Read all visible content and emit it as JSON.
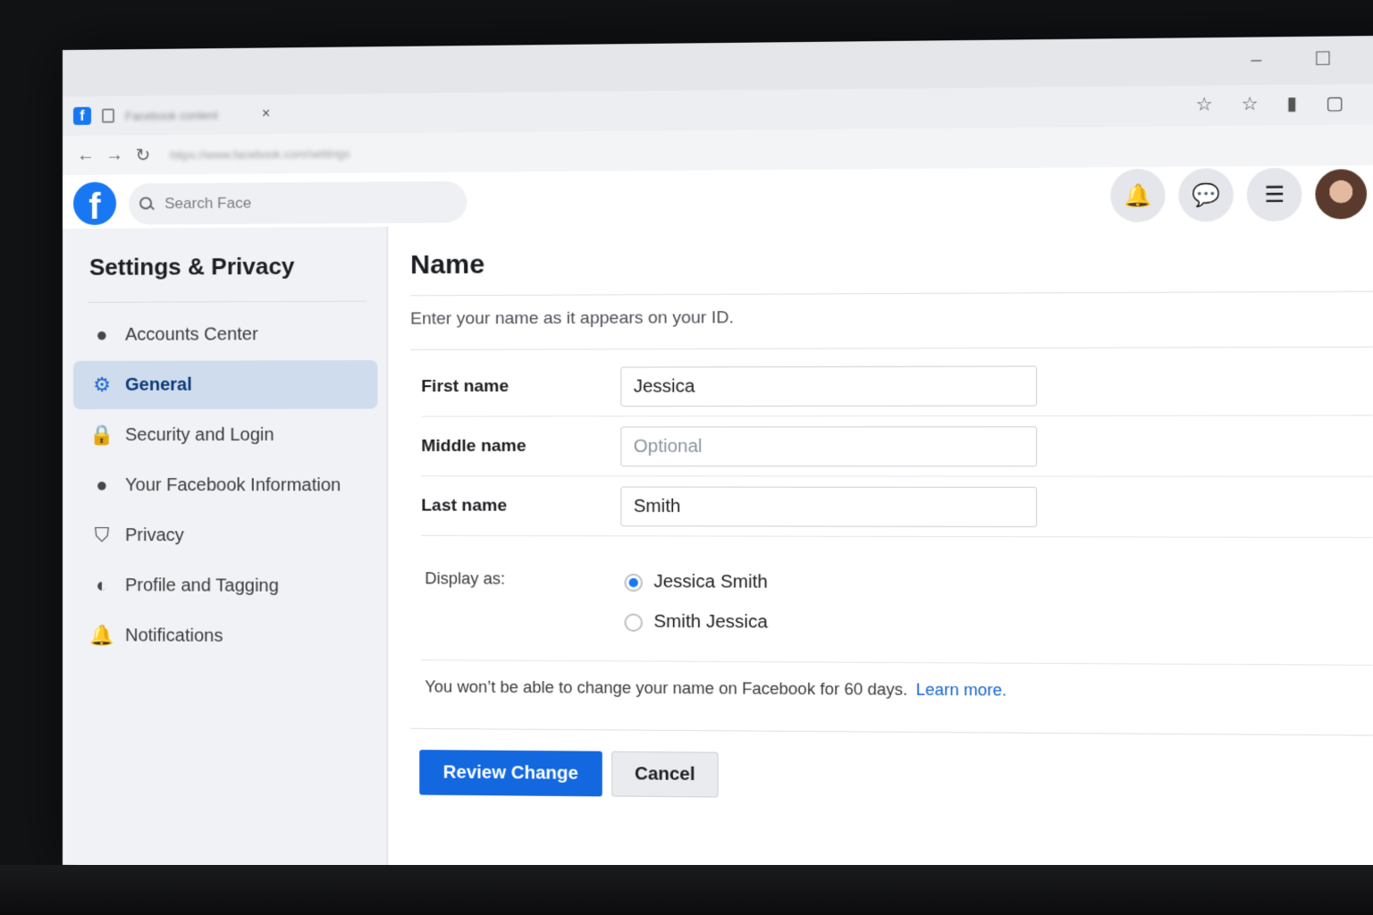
{
  "window": {
    "minimize": "–",
    "maximize": "☐",
    "close": "✕"
  },
  "browser": {
    "tab_title": "Facebook content",
    "tab_close": "×",
    "url": "https://www.facebook.com/settings",
    "nav": {
      "back": "←",
      "forward": "→",
      "reload": "↻"
    },
    "toolbar_icons": [
      "star-icon",
      "star-icon",
      "bookmark-icon",
      "window-icon",
      "more-icon"
    ]
  },
  "facebook": {
    "logo": "f",
    "search": {
      "placeholder": "Search Face"
    },
    "header_icons": [
      "bell-icon",
      "messenger-icon",
      "menu-icon"
    ]
  },
  "sidebar": {
    "title": "Settings & Privacy",
    "items": [
      {
        "label": "Accounts Center",
        "icon": "account-icon",
        "active": false
      },
      {
        "label": "General",
        "icon": "gear-icon",
        "active": true
      },
      {
        "label": "Security and Login",
        "icon": "lock-icon",
        "active": false
      },
      {
        "label": "Your Facebook Information",
        "icon": "account-icon",
        "active": false
      },
      {
        "label": "Privacy",
        "icon": "shield-icon",
        "active": false
      },
      {
        "label": "Profile and Tagging",
        "icon": "profile-tag-icon",
        "active": false
      },
      {
        "label": "Notifications",
        "icon": "bell-icon",
        "active": false
      }
    ]
  },
  "main": {
    "title": "Name",
    "subtitle": "Enter your name as it appears on your ID.",
    "fields": {
      "first": {
        "label": "First name",
        "value": "Jessica"
      },
      "middle": {
        "label": "Middle name",
        "value": "",
        "placeholder": "Optional"
      },
      "last": {
        "label": "Last name",
        "value": "Smith"
      }
    },
    "display_as": {
      "label": "Display as:",
      "options": [
        "Jessica Smith",
        "Smith Jessica"
      ],
      "selected": "Jessica Smith"
    },
    "notice": "You won’t be able to change your name on Facebook for 60 days.",
    "learn_more": "Learn more.",
    "buttons": {
      "review": "Review Change",
      "cancel": "Cancel"
    }
  },
  "colors": {
    "brand": "#1877f2",
    "primary_button": "#1368e0",
    "active_item_bg": "#cfdcee"
  }
}
